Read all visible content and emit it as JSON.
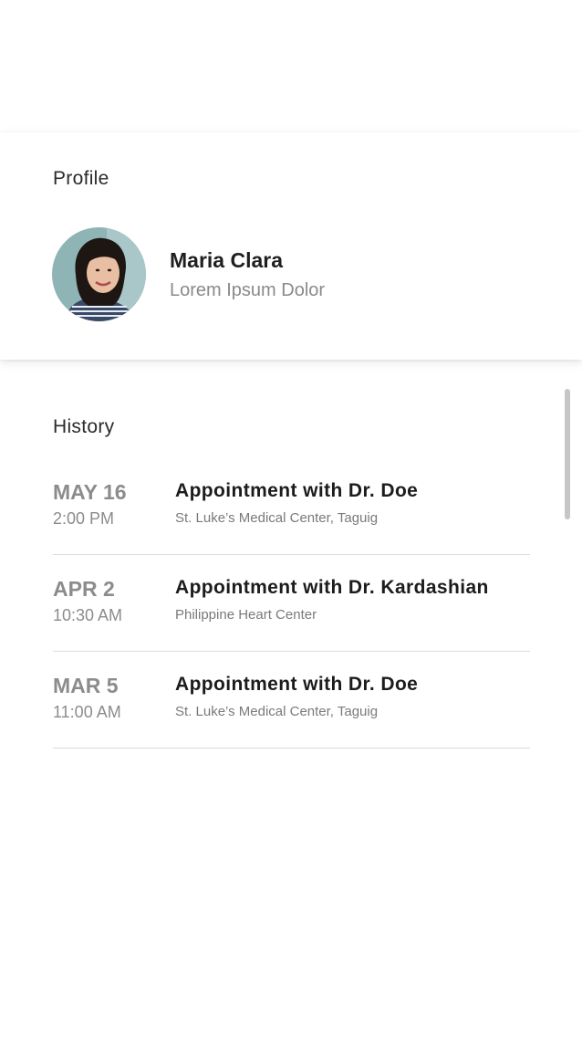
{
  "profile": {
    "section_title": "Profile",
    "name": "Maria Clara",
    "subtitle": "Lorem Ipsum Dolor"
  },
  "history": {
    "section_title": "History",
    "items": [
      {
        "date": "MAY 16",
        "time": "2:00 PM",
        "title": "Appointment with Dr. Doe",
        "place": "St. Luke’s Medical Center, Taguig"
      },
      {
        "date": "APR 2",
        "time": "10:30 AM",
        "title": "Appointment with Dr. Kardashian",
        "place": "Philippine Heart Center"
      },
      {
        "date": "MAR 5",
        "time": "11:00 AM",
        "title": "Appointment with Dr. Doe",
        "place": "St. Luke’s Medical Center, Taguig"
      }
    ]
  },
  "colors": {
    "background": "#ffffff",
    "divider": "#dcdcdc",
    "muted_text": "#8c8c8c",
    "primary_text": "#1c1c1c",
    "scrollbar": "#c6c6c6"
  }
}
